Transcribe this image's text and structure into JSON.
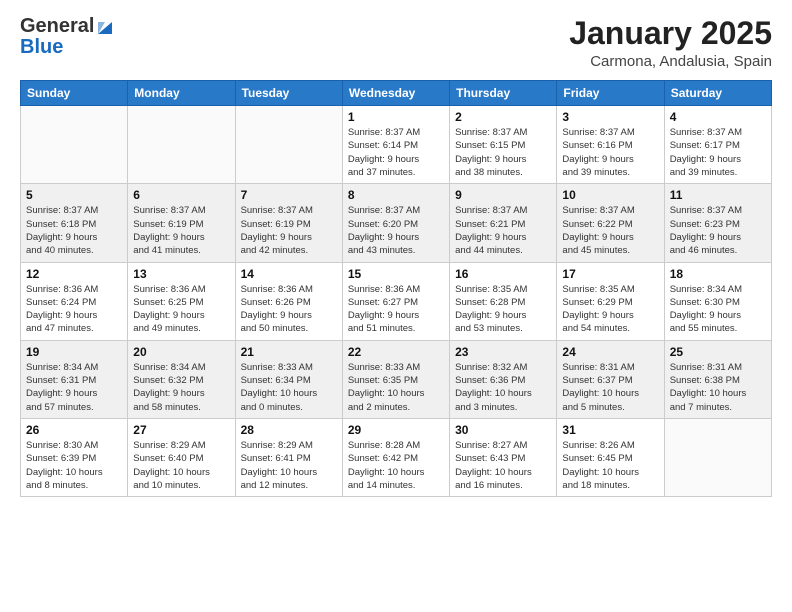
{
  "header": {
    "logo_general": "General",
    "logo_blue": "Blue",
    "title": "January 2025",
    "location": "Carmona, Andalusia, Spain"
  },
  "weekdays": [
    "Sunday",
    "Monday",
    "Tuesday",
    "Wednesday",
    "Thursday",
    "Friday",
    "Saturday"
  ],
  "weeks": [
    [
      {
        "day": "",
        "info": ""
      },
      {
        "day": "",
        "info": ""
      },
      {
        "day": "",
        "info": ""
      },
      {
        "day": "1",
        "info": "Sunrise: 8:37 AM\nSunset: 6:14 PM\nDaylight: 9 hours\nand 37 minutes."
      },
      {
        "day": "2",
        "info": "Sunrise: 8:37 AM\nSunset: 6:15 PM\nDaylight: 9 hours\nand 38 minutes."
      },
      {
        "day": "3",
        "info": "Sunrise: 8:37 AM\nSunset: 6:16 PM\nDaylight: 9 hours\nand 39 minutes."
      },
      {
        "day": "4",
        "info": "Sunrise: 8:37 AM\nSunset: 6:17 PM\nDaylight: 9 hours\nand 39 minutes."
      }
    ],
    [
      {
        "day": "5",
        "info": "Sunrise: 8:37 AM\nSunset: 6:18 PM\nDaylight: 9 hours\nand 40 minutes."
      },
      {
        "day": "6",
        "info": "Sunrise: 8:37 AM\nSunset: 6:19 PM\nDaylight: 9 hours\nand 41 minutes."
      },
      {
        "day": "7",
        "info": "Sunrise: 8:37 AM\nSunset: 6:19 PM\nDaylight: 9 hours\nand 42 minutes."
      },
      {
        "day": "8",
        "info": "Sunrise: 8:37 AM\nSunset: 6:20 PM\nDaylight: 9 hours\nand 43 minutes."
      },
      {
        "day": "9",
        "info": "Sunrise: 8:37 AM\nSunset: 6:21 PM\nDaylight: 9 hours\nand 44 minutes."
      },
      {
        "day": "10",
        "info": "Sunrise: 8:37 AM\nSunset: 6:22 PM\nDaylight: 9 hours\nand 45 minutes."
      },
      {
        "day": "11",
        "info": "Sunrise: 8:37 AM\nSunset: 6:23 PM\nDaylight: 9 hours\nand 46 minutes."
      }
    ],
    [
      {
        "day": "12",
        "info": "Sunrise: 8:36 AM\nSunset: 6:24 PM\nDaylight: 9 hours\nand 47 minutes."
      },
      {
        "day": "13",
        "info": "Sunrise: 8:36 AM\nSunset: 6:25 PM\nDaylight: 9 hours\nand 49 minutes."
      },
      {
        "day": "14",
        "info": "Sunrise: 8:36 AM\nSunset: 6:26 PM\nDaylight: 9 hours\nand 50 minutes."
      },
      {
        "day": "15",
        "info": "Sunrise: 8:36 AM\nSunset: 6:27 PM\nDaylight: 9 hours\nand 51 minutes."
      },
      {
        "day": "16",
        "info": "Sunrise: 8:35 AM\nSunset: 6:28 PM\nDaylight: 9 hours\nand 53 minutes."
      },
      {
        "day": "17",
        "info": "Sunrise: 8:35 AM\nSunset: 6:29 PM\nDaylight: 9 hours\nand 54 minutes."
      },
      {
        "day": "18",
        "info": "Sunrise: 8:34 AM\nSunset: 6:30 PM\nDaylight: 9 hours\nand 55 minutes."
      }
    ],
    [
      {
        "day": "19",
        "info": "Sunrise: 8:34 AM\nSunset: 6:31 PM\nDaylight: 9 hours\nand 57 minutes."
      },
      {
        "day": "20",
        "info": "Sunrise: 8:34 AM\nSunset: 6:32 PM\nDaylight: 9 hours\nand 58 minutes."
      },
      {
        "day": "21",
        "info": "Sunrise: 8:33 AM\nSunset: 6:34 PM\nDaylight: 10 hours\nand 0 minutes."
      },
      {
        "day": "22",
        "info": "Sunrise: 8:33 AM\nSunset: 6:35 PM\nDaylight: 10 hours\nand 2 minutes."
      },
      {
        "day": "23",
        "info": "Sunrise: 8:32 AM\nSunset: 6:36 PM\nDaylight: 10 hours\nand 3 minutes."
      },
      {
        "day": "24",
        "info": "Sunrise: 8:31 AM\nSunset: 6:37 PM\nDaylight: 10 hours\nand 5 minutes."
      },
      {
        "day": "25",
        "info": "Sunrise: 8:31 AM\nSunset: 6:38 PM\nDaylight: 10 hours\nand 7 minutes."
      }
    ],
    [
      {
        "day": "26",
        "info": "Sunrise: 8:30 AM\nSunset: 6:39 PM\nDaylight: 10 hours\nand 8 minutes."
      },
      {
        "day": "27",
        "info": "Sunrise: 8:29 AM\nSunset: 6:40 PM\nDaylight: 10 hours\nand 10 minutes."
      },
      {
        "day": "28",
        "info": "Sunrise: 8:29 AM\nSunset: 6:41 PM\nDaylight: 10 hours\nand 12 minutes."
      },
      {
        "day": "29",
        "info": "Sunrise: 8:28 AM\nSunset: 6:42 PM\nDaylight: 10 hours\nand 14 minutes."
      },
      {
        "day": "30",
        "info": "Sunrise: 8:27 AM\nSunset: 6:43 PM\nDaylight: 10 hours\nand 16 minutes."
      },
      {
        "day": "31",
        "info": "Sunrise: 8:26 AM\nSunset: 6:45 PM\nDaylight: 10 hours\nand 18 minutes."
      },
      {
        "day": "",
        "info": ""
      }
    ]
  ]
}
